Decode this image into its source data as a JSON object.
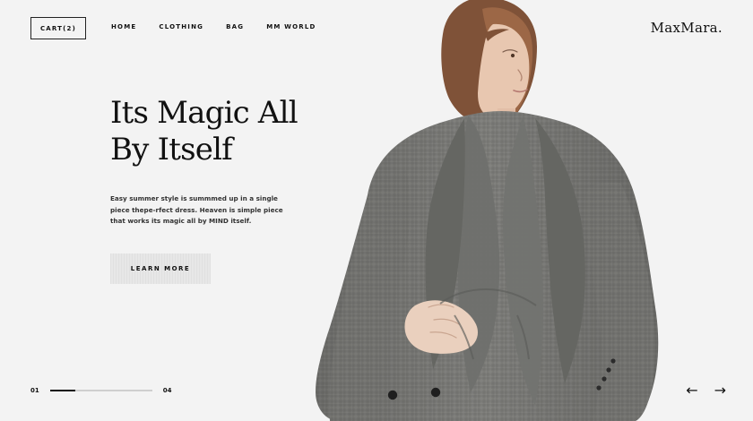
{
  "header": {
    "cart_label": "CART(2)",
    "logo": "MaxMara.",
    "nav": [
      {
        "label": "HOME"
      },
      {
        "label": "CLOTHING"
      },
      {
        "label": "BAG"
      },
      {
        "label": "MM WORLD"
      }
    ]
  },
  "hero": {
    "title_line_1": "Its Magic All",
    "title_line_2": "By Itself",
    "description": "Easy summer style is summmed up in a single piece  thepe-rfect dress. Heaven is simple piece that works its magic all by MIND itself.",
    "cta_label": "LEARN MORE"
  },
  "pager": {
    "current": "01",
    "total": "04",
    "progress_fraction": 0.25
  },
  "navigation": {
    "prev_icon": "arrow-left-icon",
    "next_icon": "arrow-right-icon"
  },
  "colors": {
    "background": "#f3f3f3",
    "text": "#111111",
    "button_fill": "#e7e7e7",
    "jacket": "#7a7a78",
    "skin": "#e6c3aa",
    "hair": "#8a5a3c"
  }
}
